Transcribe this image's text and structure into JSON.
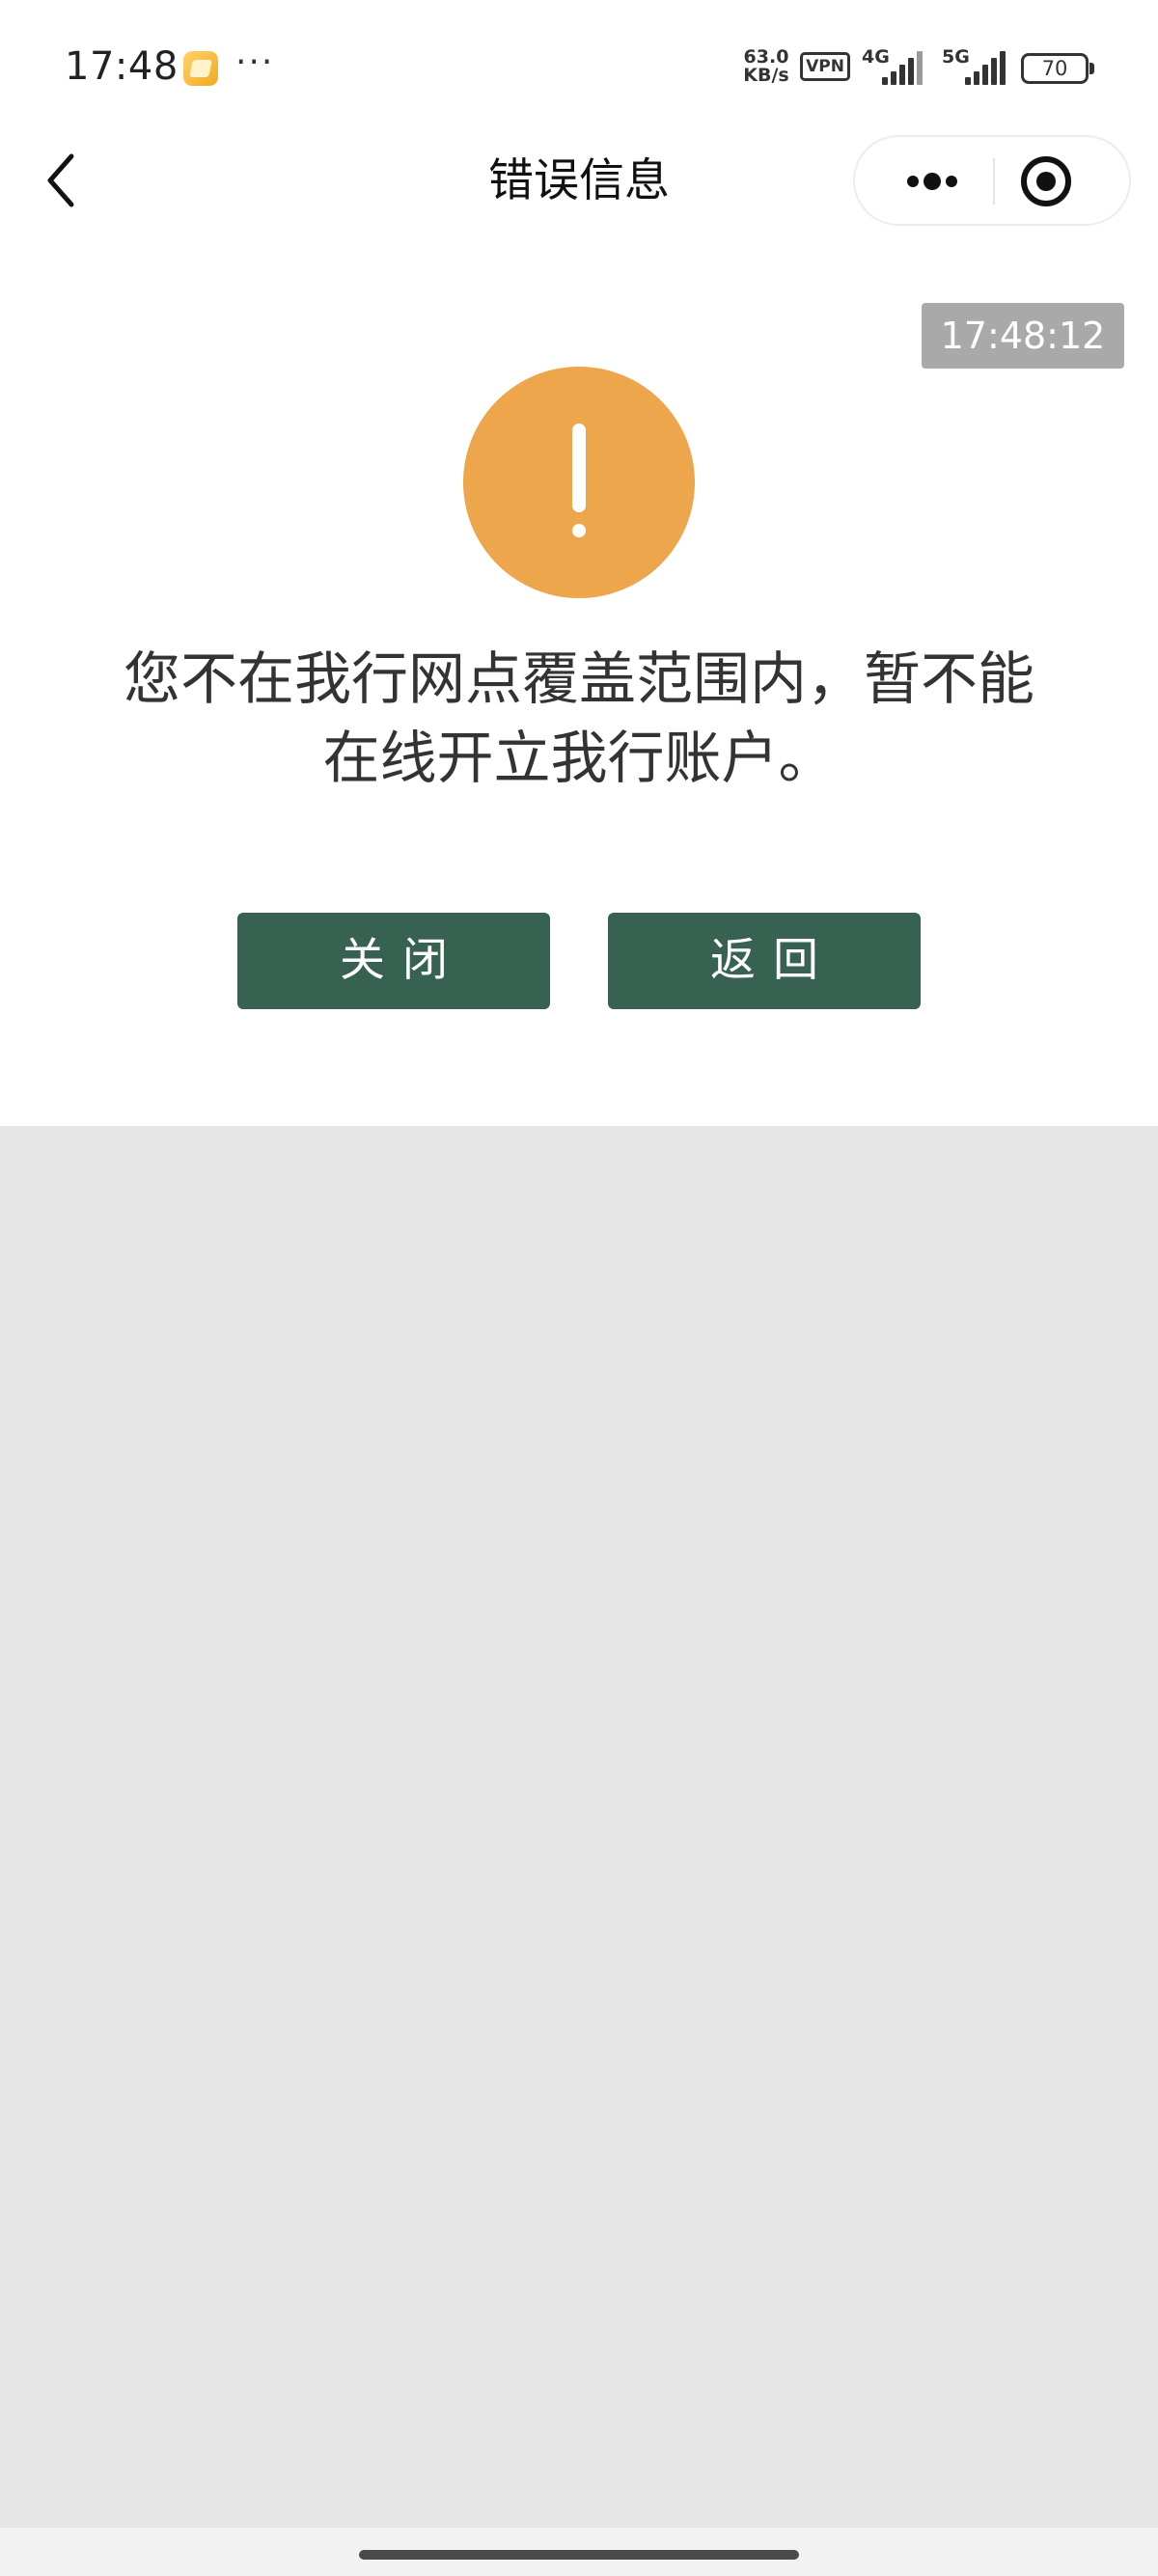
{
  "status_bar": {
    "time": "17:48",
    "app_icon": "note-app-icon",
    "more": "···",
    "speed_value": "63.0",
    "speed_unit": "KB/s",
    "vpn": "VPN",
    "network_1": "4G",
    "network_2": "5G",
    "battery": "70"
  },
  "nav": {
    "back_icon": "chevron-left-icon",
    "title": "错误信息",
    "more_icon": "more-dots-icon",
    "close_icon": "target-circle-icon"
  },
  "content": {
    "timestamp": "17:48:12",
    "alert_icon": "exclamation-icon",
    "message_line1": "您不在我行网点覆盖范围内，暂不能",
    "message_line2": "在线开立我行账户。",
    "close_button": "关闭",
    "back_button": "返回"
  },
  "colors": {
    "button": "#376150",
    "alert": "#eda64b",
    "timestamp_bg": "#a9a9a9",
    "background": "#e6e6e6"
  }
}
